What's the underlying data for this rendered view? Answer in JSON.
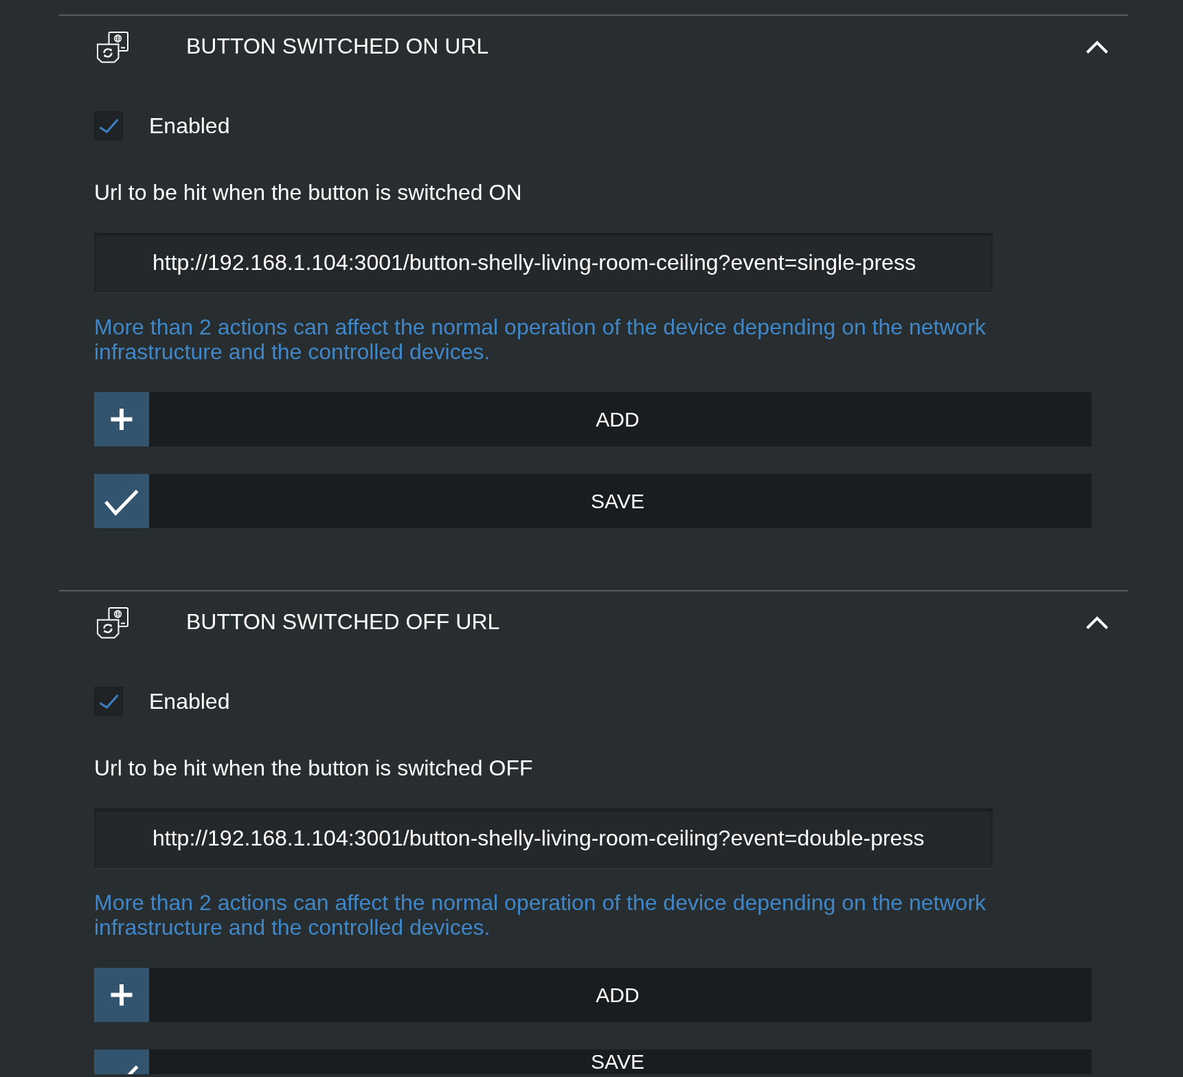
{
  "sections": [
    {
      "title": "BUTTON SWITCHED ON URL",
      "expanded": true,
      "enabled": {
        "label": "Enabled",
        "checked": true
      },
      "url_label": "Url to be hit when the button is switched ON",
      "url_field": {
        "value": "http://192.168.1.104:3001/button-shelly-living-room-ceiling?event=single-press"
      },
      "note": "More than 2 actions can affect the normal operation of the device depending on the network infrastructure and the controlled devices.",
      "buttons": [
        {
          "kind": "add",
          "label": "ADD"
        },
        {
          "kind": "save",
          "label": "SAVE"
        }
      ]
    },
    {
      "title": "BUTTON SWITCHED OFF URL",
      "expanded": true,
      "enabled": {
        "label": "Enabled",
        "checked": true
      },
      "url_label": "Url to be hit when the button is switched OFF",
      "url_field": {
        "value": "http://192.168.1.104:3001/button-shelly-living-room-ceiling?event=double-press"
      },
      "note": "More than 2 actions can affect the normal operation of the device depending on the network infrastructure and the controlled devices.",
      "buttons": [
        {
          "kind": "add",
          "label": "ADD"
        },
        {
          "kind": "save",
          "label": "SAVE"
        }
      ]
    }
  ]
}
